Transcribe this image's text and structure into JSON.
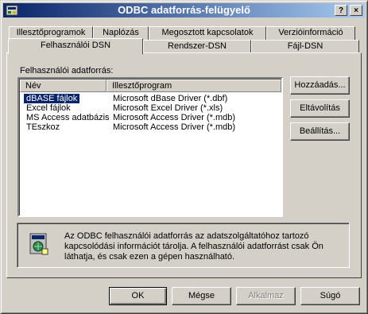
{
  "window": {
    "title": "ODBC adatforrás-felügyelő",
    "help_button": "?",
    "close_button": "×"
  },
  "tabs_back": [
    "Illesztőprogramok",
    "Naplózás",
    "Megosztott kapcsolatok",
    "Verzióinformáció"
  ],
  "tabs_front": [
    "Felhasználói DSN",
    "Rendszer-DSN",
    "Fájl-DSN"
  ],
  "active_tab": "Felhasználói DSN",
  "panel": {
    "list_label": "Felhasználói adatforrás:",
    "columns": [
      "Név",
      "Illesztőprogram"
    ],
    "rows": [
      {
        "name": "dBASE fájlok",
        "driver": "Microsoft dBase Driver (*.dbf)",
        "selected": true
      },
      {
        "name": "Excel fájlok",
        "driver": "Microsoft Excel Driver (*.xls)",
        "selected": false
      },
      {
        "name": "MS Access adatbázis",
        "driver": "Microsoft Access Driver (*.mdb)",
        "selected": false
      },
      {
        "name": "TEszkoz",
        "driver": "Microsoft Access Driver (*.mdb)",
        "selected": false
      }
    ],
    "buttons": {
      "add": "Hozzáadás...",
      "remove": "Eltávolítás",
      "configure": "Beállítás..."
    },
    "info_text": "Az ODBC felhasználói adatforrás az adatszolgáltatóhoz tartozó kapcsolódási információt tárolja. A felhasználói adatforrást csak Ön láthatja, és csak ezen a gépen használható."
  },
  "footer": {
    "ok": "OK",
    "cancel": "Mégse",
    "apply": "Alkalmaz",
    "help": "Súgó"
  },
  "colors": {
    "titlebar_start": "#0a246a",
    "titlebar_end": "#a6caf0",
    "face": "#d4d0c8",
    "selection": "#0a246a"
  }
}
